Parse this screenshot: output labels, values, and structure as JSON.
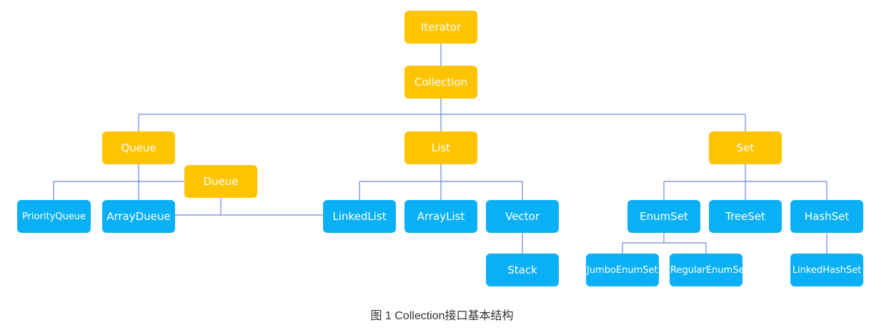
{
  "colors": {
    "interface": "#FFC400",
    "implementation": "#0AB0F5",
    "connector": "#6C84E0"
  },
  "nodes": {
    "iterator": "Iterator",
    "collection": "Collection",
    "queue": "Queue",
    "list": "List",
    "set": "Set",
    "dueue": "Dueue",
    "priority_queue": "PriorityQueue",
    "array_dueue": "ArrayDueue",
    "linked_list": "LinkedList",
    "array_list": "ArrayList",
    "vector": "Vector",
    "stack": "Stack",
    "enum_set": "EnumSet",
    "tree_set": "TreeSet",
    "hash_set": "HashSet",
    "jumbo_enum_set": "JumboEnumSet",
    "regular_enum_set": "RegularEnumSet",
    "linked_hash_set": "LinkedHashSet"
  },
  "caption": "图 1  Collection接口基本结构"
}
